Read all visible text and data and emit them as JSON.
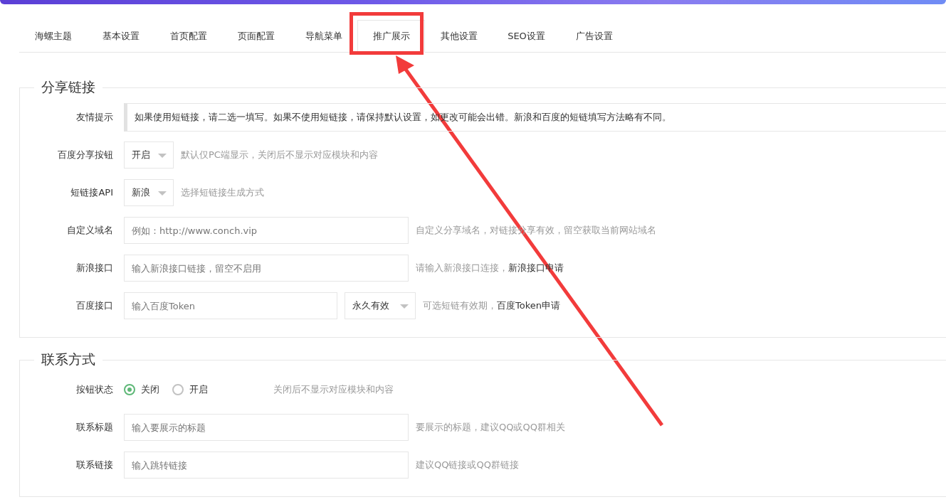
{
  "tabs": [
    {
      "label": "海螺主题",
      "selected": false
    },
    {
      "label": "基本设置",
      "selected": false
    },
    {
      "label": "首页配置",
      "selected": false
    },
    {
      "label": "页面配置",
      "selected": false
    },
    {
      "label": "导航菜单",
      "selected": false
    },
    {
      "label": "推广展示",
      "selected": true
    },
    {
      "label": "其他设置",
      "selected": false
    },
    {
      "label": "SEO设置",
      "selected": false
    },
    {
      "label": "广告设置",
      "selected": false
    }
  ],
  "sections": [
    {
      "title": "分享链接",
      "rows": [
        {
          "kind": "tip",
          "label": "友情提示",
          "text": "如果使用短链接，请二选一填写。如果不使用短链接，请保持默认设置，如更改可能会出错。新浪和百度的短链填写方法略有不同。"
        },
        {
          "kind": "select",
          "label": "百度分享按钮",
          "value": "开启",
          "hint": "默认仅PC端显示，关闭后不显示对应模块和内容"
        },
        {
          "kind": "select",
          "label": "短链接API",
          "value": "新浪",
          "hint": "选择短链接生成方式"
        },
        {
          "kind": "input",
          "label": "自定义域名",
          "placeholder": "例如：http://www.conch.vip",
          "hint": "自定义分享域名，对链接分享有效，留空获取当前网站域名"
        },
        {
          "kind": "input",
          "label": "新浪接口",
          "placeholder": "输入新浪接口链接，留空不启用",
          "hint": "请输入新浪接口连接，",
          "link": "新浪接口申请"
        },
        {
          "kind": "input_select",
          "label": "百度接口",
          "placeholder": "输入百度Token",
          "value": "永久有效",
          "hint": "可选短链有效期，",
          "link": "百度Token申请"
        }
      ]
    },
    {
      "title": "联系方式",
      "rows": [
        {
          "kind": "radio",
          "label": "按钮状态",
          "options": [
            {
              "label": "关闭",
              "selected": true
            },
            {
              "label": "开启",
              "selected": false
            }
          ],
          "hint": "关闭后不显示对应模块和内容"
        },
        {
          "kind": "input",
          "label": "联系标题",
          "placeholder": "输入要展示的标题",
          "hint": "要展示的标题，建议QQ或QQ群相关"
        },
        {
          "kind": "input",
          "label": "联系链接",
          "placeholder": "输入跳转链接",
          "hint": "建议QQ链接或QQ群链接"
        }
      ]
    }
  ]
}
